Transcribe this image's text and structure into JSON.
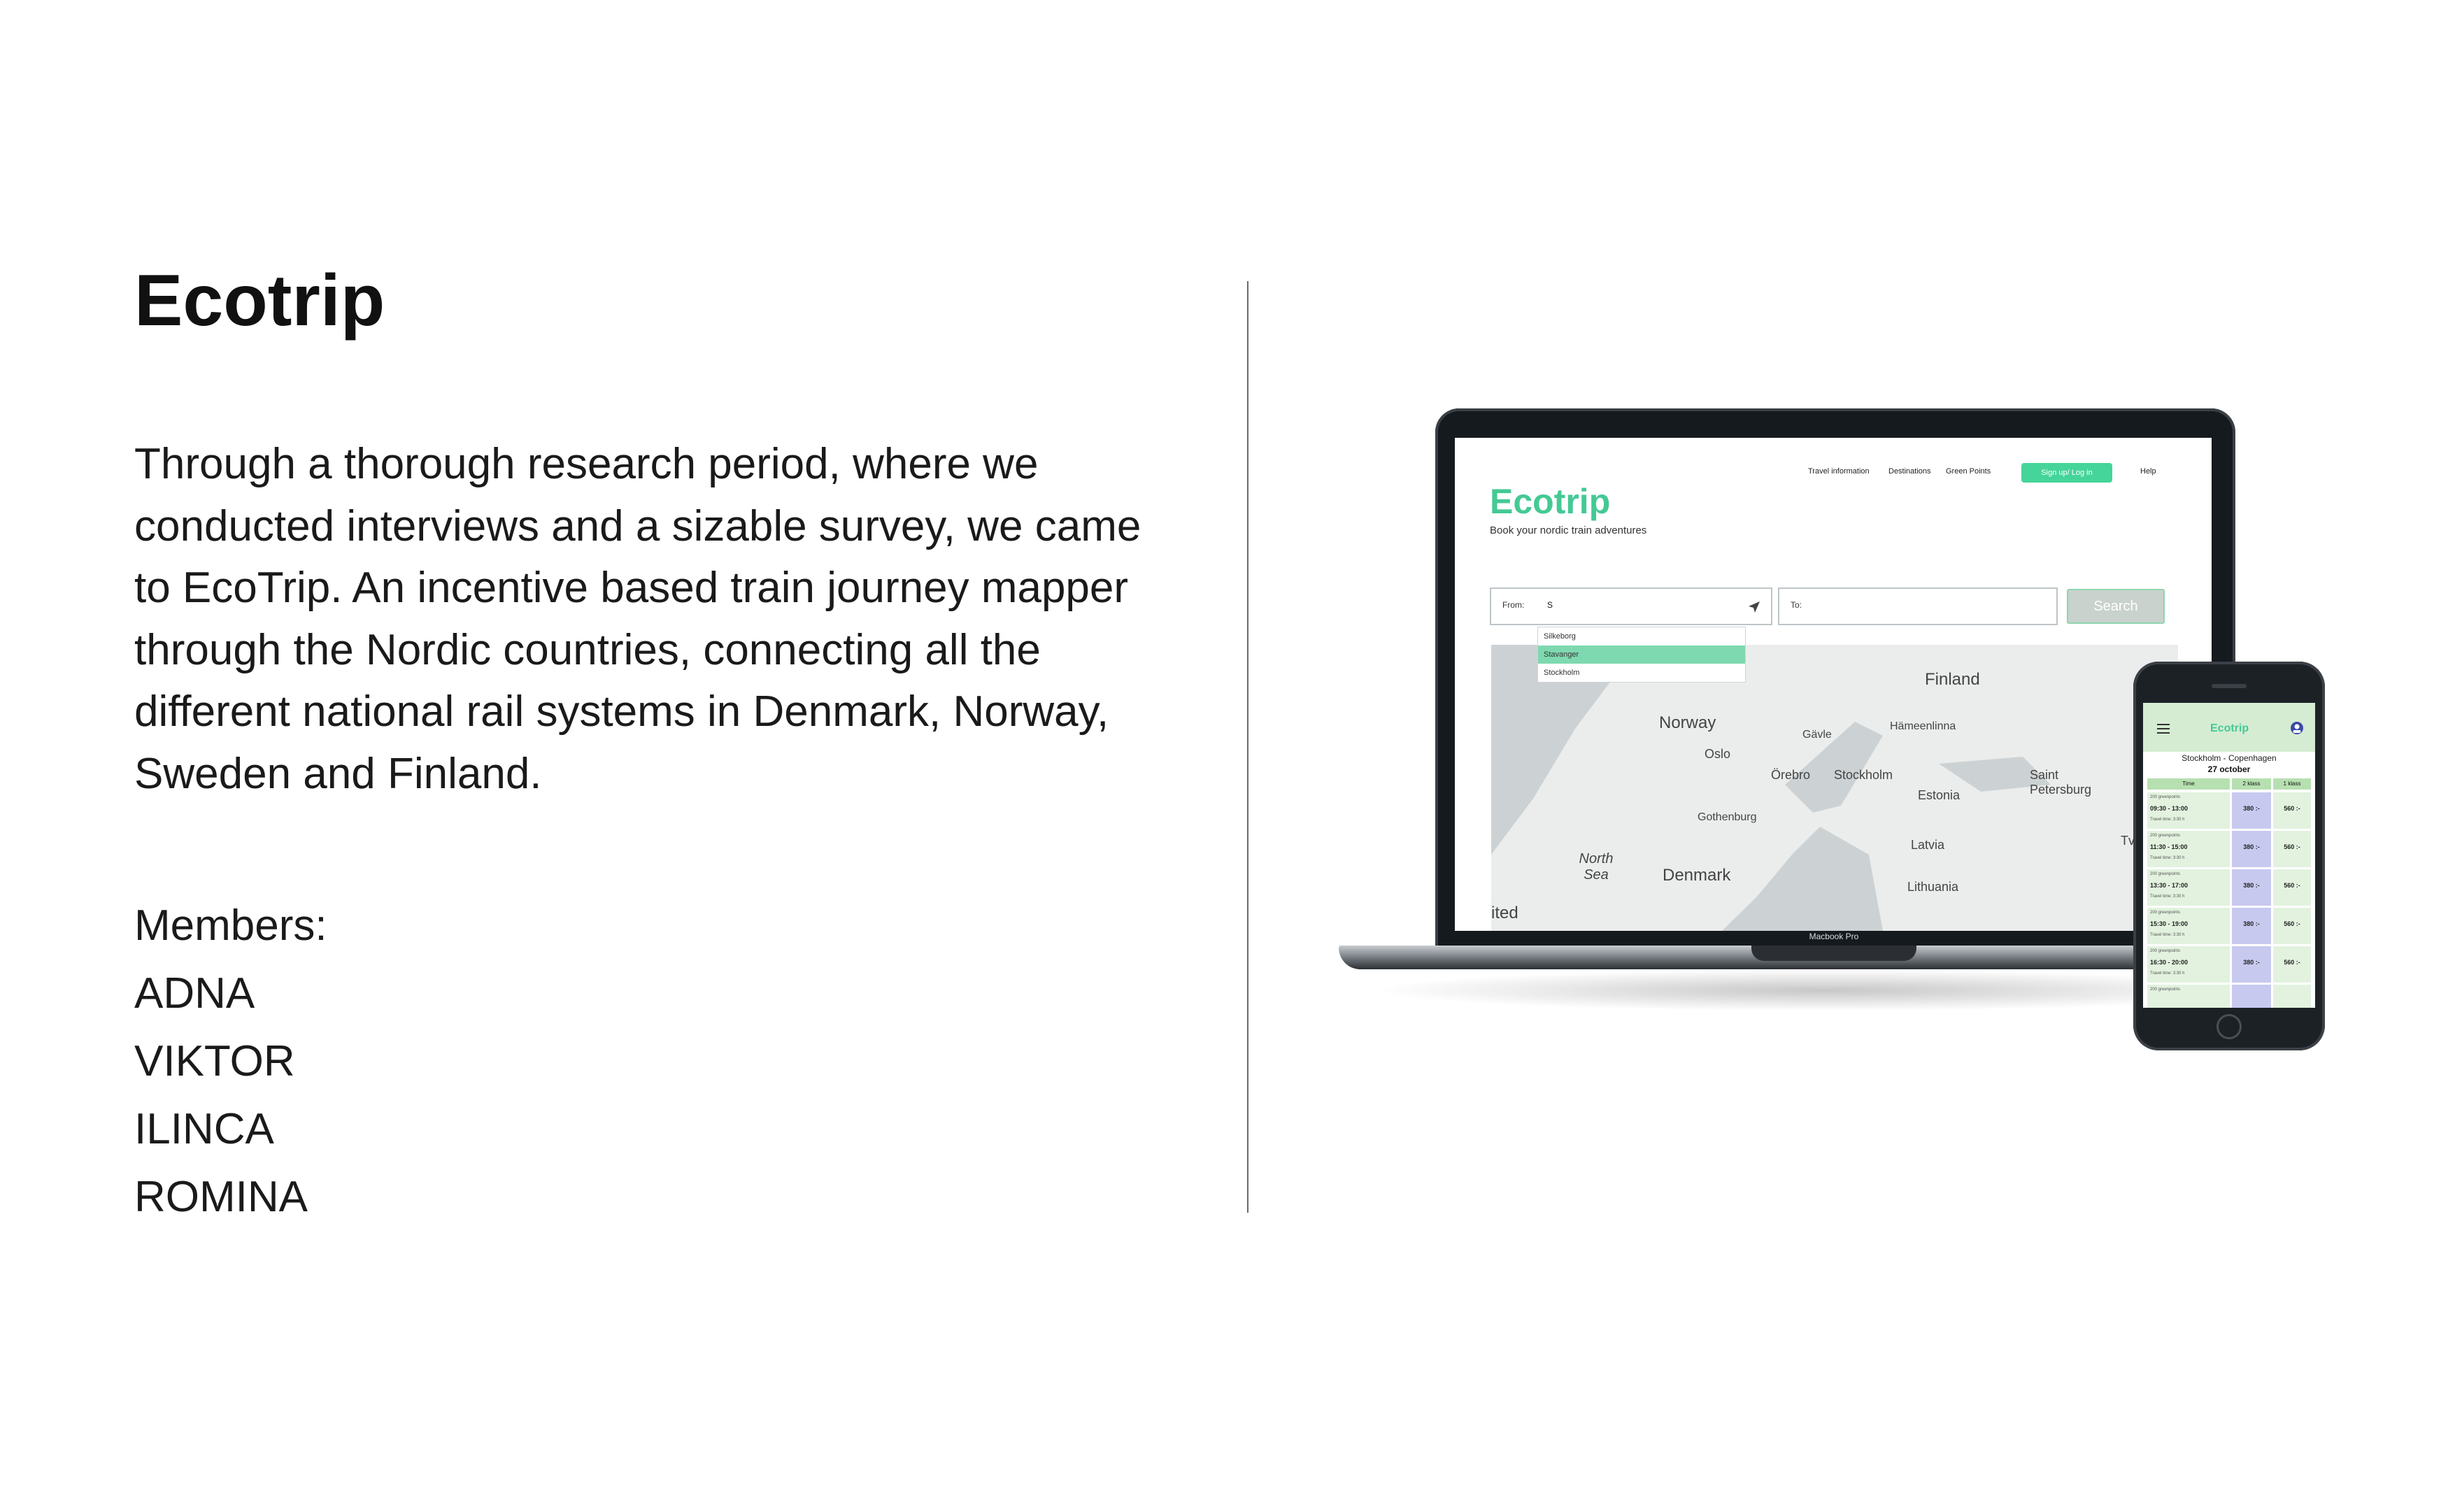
{
  "title": "Ecotrip",
  "description": "Through a thorough research period, where we conducted interviews and a sizable survey, we came to EcoTrip. An incentive based train journey mapper through the Nordic countries, connecting all the different national rail systems in Denmark, Norway, Sweden and Finland.",
  "members_label": "Members:",
  "members": [
    "ADNA",
    "VIKTOR",
    "ILINCA",
    "ROMINA"
  ],
  "laptop": {
    "device_label": "Macbook Pro",
    "logo": "Ecotrip",
    "tagline": "Book your nordic train adventures",
    "nav": [
      "Travel information",
      "Destinations",
      "Green Points",
      "Help"
    ],
    "signup_label": "Sign up/ Log in",
    "from_label": "From:",
    "from_value": "S",
    "to_label": "To:",
    "search_label": "Search",
    "suggestions": [
      "Silkeborg",
      "Stavanger",
      "Stockholm"
    ],
    "active_suggestion": "Stavanger",
    "map_labels": [
      "Finland",
      "Norway",
      "Hämeenlinna",
      "Gävle",
      "Oslo",
      "Örebro",
      "Stockholm",
      "Saint Petersburg",
      "Estonia",
      "Gothenburg",
      "North Sea",
      "Latvia",
      "Denmark",
      "Lithuania",
      "Tver",
      "ited"
    ]
  },
  "phone": {
    "logo": "Ecotrip",
    "route": "Stockholm - Copenhagen",
    "date": "27 october",
    "columns": [
      "Time",
      "2 klass",
      "1 klass"
    ],
    "rows": [
      {
        "points": "200 greenpoints",
        "time": "09:30 - 13:00",
        "travel": "Travel time: 3:30 h",
        "second": "380 :-",
        "first": "560 :-"
      },
      {
        "points": "200 greenpoints",
        "time": "11:30 - 15:00",
        "travel": "Travel time: 3:30 h",
        "second": "380 :-",
        "first": "560 :-"
      },
      {
        "points": "200 greenpoints",
        "time": "13:30 - 17:00",
        "travel": "Travel time: 3:30 h",
        "second": "380 :-",
        "first": "560 :-"
      },
      {
        "points": "200 greenpoints",
        "time": "15:30 - 19:00",
        "travel": "Travel time: 3:30 h",
        "second": "380 :-",
        "first": "560 :-"
      },
      {
        "points": "200 greenpoints",
        "time": "16:30 - 20:00",
        "travel": "Travel time: 3:30 h",
        "second": "380 :-",
        "first": "560 :-"
      },
      {
        "points": "200 greenpoints",
        "time": "",
        "travel": "",
        "second": "",
        "first": ""
      }
    ]
  },
  "colors": {
    "brand_green": "#45c994",
    "divider": "#6b6b6b"
  }
}
